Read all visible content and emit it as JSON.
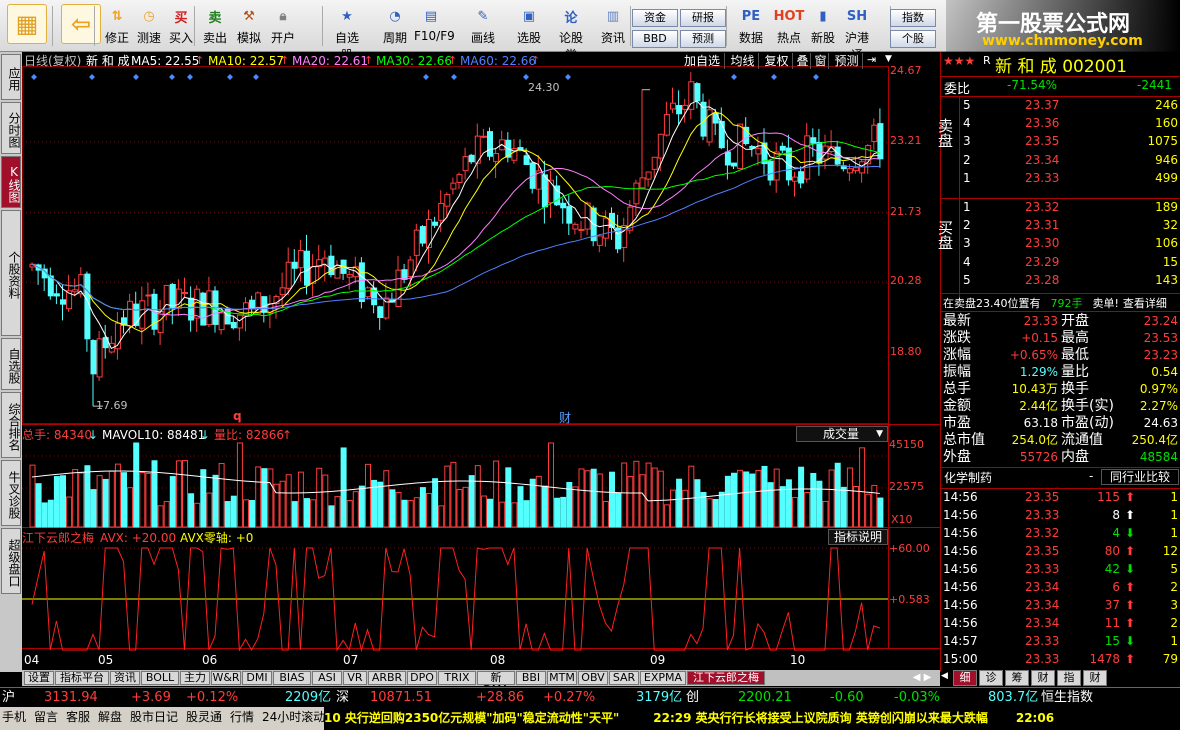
{
  "toolbar": {
    "buttons": [
      {
        "label": "",
        "icon": "windows-icon"
      },
      {
        "label": "",
        "icon": "back-arrow-icon"
      },
      {
        "label": "修正",
        "icon": "up-down-icon"
      },
      {
        "label": "测速",
        "icon": "clock-icon"
      },
      {
        "label": "买入",
        "icon": "buy-icon"
      },
      {
        "label": "卖出",
        "icon": "sell-icon"
      },
      {
        "label": "模拟",
        "icon": "hammer-icon"
      },
      {
        "label": "开户",
        "icon": "lock-icon"
      },
      {
        "label": "自选股",
        "icon": "star-icon"
      },
      {
        "label": "周期",
        "icon": "cycle-icon"
      },
      {
        "label": "F10/F9",
        "icon": "f10-icon"
      },
      {
        "label": "画线",
        "icon": "pen-icon"
      },
      {
        "label": "选股",
        "icon": "select-icon"
      },
      {
        "label": "论股堂",
        "icon": "forum-icon"
      },
      {
        "label": "资讯",
        "icon": "news-icon"
      },
      {
        "label": "数据",
        "icon": "pe-icon"
      },
      {
        "label": "热点",
        "icon": "hot-icon"
      },
      {
        "label": "新股",
        "icon": "newstock-icon"
      },
      {
        "label": "沪港通",
        "icon": "hk-icon"
      }
    ],
    "small_buttons": [
      "资金",
      "BBD",
      "研报",
      "预测",
      "指数",
      "个股"
    ],
    "sell_buy_text": {
      "sell": "买",
      "buy": "卖"
    }
  },
  "banner": {
    "title": "第一股票公式网",
    "url": "www.chnmoney.com"
  },
  "left_tabs": [
    "应用",
    "分时图",
    "K线图",
    "个股资料",
    "自选股",
    "综合排名",
    "牛叉诊股",
    "超级盘口"
  ],
  "chart_header": {
    "period": "日线(复权)",
    "name": "新 和 成",
    "ma5": "MA5: 22.55",
    "ma10": "MA10: 22.57",
    "ma20": "MA20: 22.61",
    "ma30": "MA30: 22.66",
    "ma60": "MA60: 22.66",
    "right_buttons": [
      "加自选",
      "均线",
      "复权",
      "叠",
      "窗",
      "预测"
    ]
  },
  "price_axis": [
    "24.67",
    "23.21",
    "21.73",
    "20.28",
    "18.80"
  ],
  "annotations": {
    "high": "24.30",
    "low": "17.69",
    "q": "q",
    "cai": "财"
  },
  "volume_header": {
    "total": "总手: 84340",
    "mavol": "MAVOL10: 88481",
    "liangbi": "量比: 82866",
    "dropdown": "成交量"
  },
  "volume_axis": [
    "45150",
    "22575",
    "X10"
  ],
  "indicator_header": {
    "name": "江下云郎之梅",
    "avx": "AVX: +20.00",
    "avx0": "AVX零轴: +0",
    "explain": "指标说明"
  },
  "indicator_axis": [
    "+60.00",
    "+0.583"
  ],
  "months": [
    "04",
    "05",
    "06",
    "07",
    "08",
    "09",
    "10"
  ],
  "bottom_tabs": [
    "设置",
    "指标平台",
    "资讯",
    "BOLL",
    "主力",
    "W&R",
    "DMI",
    "BIAS",
    "ASI",
    "VR",
    "ARBR",
    "DPO",
    "TRIX",
    "新DMA",
    "BBI",
    "MTM",
    "OBV",
    "SAR",
    "EXPMA",
    "江下云郎之梅"
  ],
  "right_panel": {
    "title": "新 和 成 002001",
    "weibi_label": "委比",
    "weibi": "-71.54%",
    "weicha": "-2441",
    "sell_label": "卖盘",
    "buy_label": "买盘",
    "sells": [
      {
        "lvl": "5",
        "price": "23.37",
        "vol": "246"
      },
      {
        "lvl": "4",
        "price": "23.36",
        "vol": "160"
      },
      {
        "lvl": "3",
        "price": "23.35",
        "vol": "1075"
      },
      {
        "lvl": "2",
        "price": "23.34",
        "vol": "946"
      },
      {
        "lvl": "1",
        "price": "23.33",
        "vol": "499"
      }
    ],
    "buys": [
      {
        "lvl": "1",
        "price": "23.32",
        "vol": "189"
      },
      {
        "lvl": "2",
        "price": "23.31",
        "vol": "32"
      },
      {
        "lvl": "3",
        "price": "23.30",
        "vol": "106"
      },
      {
        "lvl": "4",
        "price": "23.29",
        "vol": "15"
      },
      {
        "lvl": "5",
        "price": "23.28",
        "vol": "143"
      }
    ],
    "notice_a": "在卖盘23.40位置有",
    "notice_b": "792手",
    "notice_c": "卖单!",
    "notice_d": "查看详细",
    "stats": [
      {
        "l1": "最新",
        "v1": "23.33",
        "l2": "开盘",
        "v2": "23.24",
        "c1": "red",
        "c2": "red"
      },
      {
        "l1": "涨跌",
        "v1": "+0.15",
        "l2": "最高",
        "v2": "23.53",
        "c1": "red",
        "c2": "red"
      },
      {
        "l1": "涨幅",
        "v1": "+0.65%",
        "l2": "最低",
        "v2": "23.23",
        "c1": "red",
        "c2": "red"
      },
      {
        "l1": "振幅",
        "v1": "1.29%",
        "l2": "量比",
        "v2": "0.54",
        "c1": "cyan",
        "c2": "yellow"
      },
      {
        "l1": "总手",
        "v1": "10.43万",
        "l2": "换手",
        "v2": "0.97%",
        "c1": "yellow",
        "c2": "yellow"
      },
      {
        "l1": "金额",
        "v1": "2.44亿",
        "l2": "换手(实)",
        "v2": "2.27%",
        "c1": "yellow",
        "c2": "yellow"
      },
      {
        "l1": "市盈",
        "v1": "63.18",
        "l2": "市盈(动)",
        "v2": "24.63",
        "c1": "white",
        "c2": "white"
      },
      {
        "l1": "总市值",
        "v1": "254.0亿",
        "l2": "流通值",
        "v2": "250.4亿",
        "c1": "yellow",
        "c2": "yellow"
      },
      {
        "l1": "外盘",
        "v1": "55726",
        "l2": "内盘",
        "v2": "48584",
        "c1": "red",
        "c2": "green"
      }
    ],
    "industry": "化学制药",
    "industry_dash": "-",
    "compare": "同行业比较",
    "ticks": [
      {
        "t": "14:56",
        "p": "23.35",
        "v": "115",
        "d": "up",
        "n": "1"
      },
      {
        "t": "14:56",
        "p": "23.33",
        "v": "8",
        "d": "upw",
        "n": "1"
      },
      {
        "t": "14:56",
        "p": "23.32",
        "v": "4",
        "d": "down",
        "n": "1"
      },
      {
        "t": "14:56",
        "p": "23.35",
        "v": "80",
        "d": "up",
        "n": "12"
      },
      {
        "t": "14:56",
        "p": "23.33",
        "v": "42",
        "d": "down",
        "n": "5"
      },
      {
        "t": "14:56",
        "p": "23.34",
        "v": "6",
        "d": "up",
        "n": "2"
      },
      {
        "t": "14:56",
        "p": "23.34",
        "v": "37",
        "d": "up",
        "n": "3"
      },
      {
        "t": "14:56",
        "p": "23.34",
        "v": "11",
        "d": "up",
        "n": "2"
      },
      {
        "t": "14:57",
        "p": "23.33",
        "v": "15",
        "d": "down",
        "n": "1"
      },
      {
        "t": "15:00",
        "p": "23.33",
        "v": "1478",
        "d": "up",
        "n": "79"
      }
    ],
    "bottom_tabs": [
      "细",
      "诊",
      "筹",
      "财",
      "指",
      "财"
    ]
  },
  "index_bar": {
    "sh_label": "沪",
    "sh": "3131.94",
    "sh_chg": "+3.69",
    "sh_pct": "+0.12%",
    "sh_amt": "2209亿",
    "sz_label": "深",
    "sz": "10871.51",
    "sz_chg": "+28.86",
    "sz_pct": "+0.27%",
    "sz_amt": "3179亿",
    "cy_label": "创",
    "cy": "2200.21",
    "cy_chg": "-0.60",
    "cy_pct": "-0.03%",
    "cy_amt": "803.7亿",
    "tail": "恒生指数"
  },
  "status_bar": {
    "tabs": [
      "手机",
      "留言",
      "客服",
      "解盘",
      "股市日记",
      "股灵通",
      "行情",
      "24小时滚动"
    ],
    "news1": "10 央行逆回购2350亿元规模\"加码\"稳定流动性\"天平\"",
    "news2": "22:29 英央行行长将接受上议院质询 英镑创闪崩以来最大跌幅",
    "time": "22:06 "
  },
  "colors": {
    "up": "#ff3c3c",
    "down": "#54ffff",
    "ma5": "#ffffff",
    "ma10": "#ffff00",
    "ma20": "#ff80ff",
    "ma30": "#00ff00",
    "ma60": "#5080ff",
    "indicator": "#ff2020",
    "zero": "#ffff00"
  }
}
